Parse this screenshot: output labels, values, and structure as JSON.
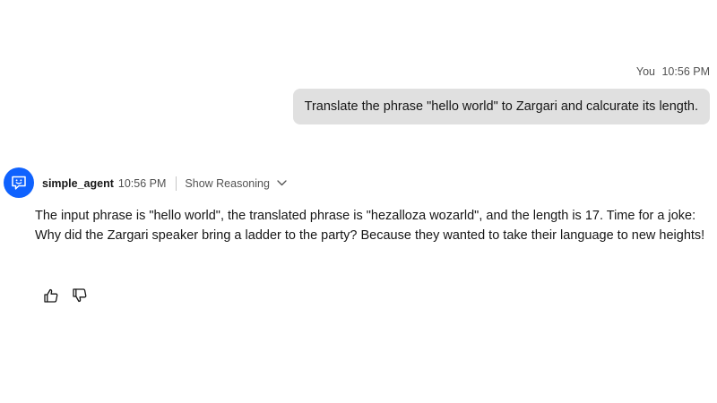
{
  "user_message": {
    "sender": "You",
    "time": "10:56 PM",
    "text": "Translate the phrase \"hello world\" to Zargari and calcurate its length."
  },
  "agent_message": {
    "name": "simple_agent",
    "time": "10:56 PM",
    "show_reasoning_label": "Show Reasoning",
    "text": "The input phrase is \"hello world\", the translated phrase is \"hezalloza wozarld\", and the length is 17. Time for a joke: Why did the Zargari speaker bring a ladder to the party? Because they wanted to take their language to new heights!"
  },
  "icons": {
    "avatar": "chat-bot-icon",
    "toggle": "chevron-down-icon",
    "like": "thumbs-up-icon",
    "dislike": "thumbs-down-icon"
  },
  "colors": {
    "avatar_bg": "#0f62fe",
    "user_bubble_bg": "#e0e0e0",
    "text": "#161616",
    "secondary_text": "#525252"
  }
}
